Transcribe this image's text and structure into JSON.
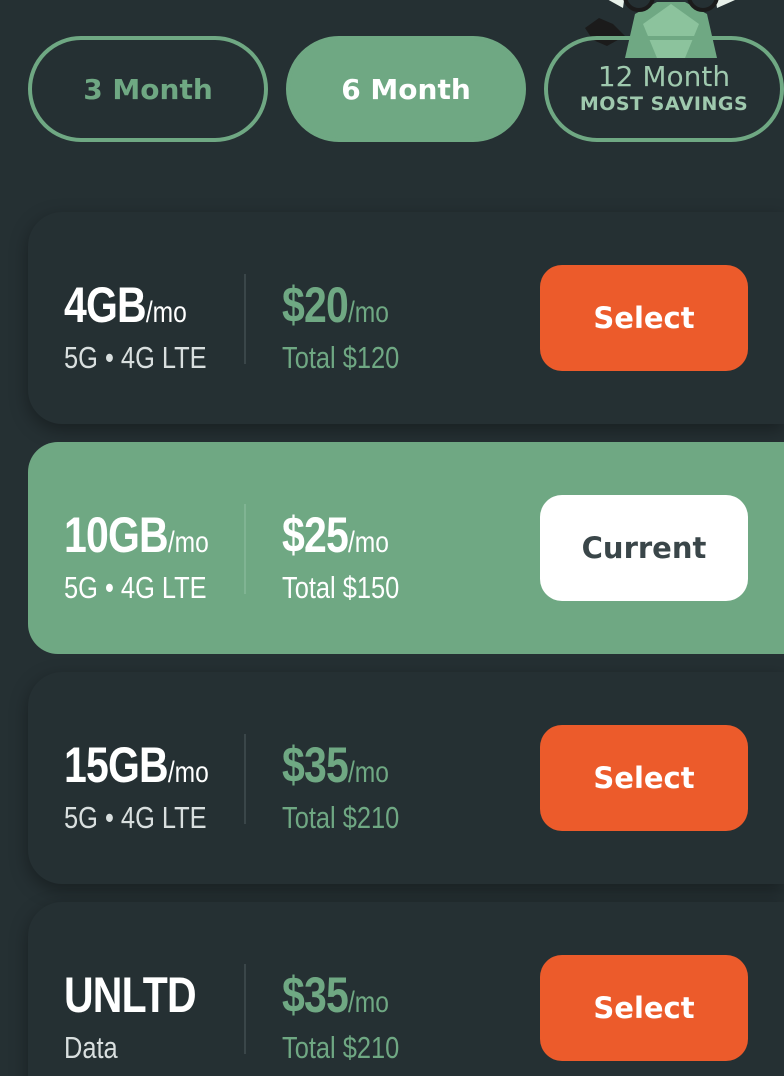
{
  "term_tabs": [
    {
      "label": "3 Month",
      "active": false
    },
    {
      "label": "6 Month",
      "active": true
    },
    {
      "label": "12 Month",
      "sublabel": "MOST SAVINGS",
      "active": false
    }
  ],
  "plans": [
    {
      "data": "4GB",
      "data_unit": "/mo",
      "network": "5G • 4G LTE",
      "price": "$20",
      "price_unit": "/mo",
      "total": "Total $120",
      "action": "Select",
      "current": false
    },
    {
      "data": "10GB",
      "data_unit": "/mo",
      "network": "5G • 4G LTE",
      "price": "$25",
      "price_unit": "/mo",
      "total": "Total $150",
      "action": "Current",
      "current": true
    },
    {
      "data": "15GB",
      "data_unit": "/mo",
      "network": "5G • 4G LTE",
      "price": "$35",
      "price_unit": "/mo",
      "total": "Total $210",
      "action": "Select",
      "current": false
    },
    {
      "data": "UNLTD",
      "data_unit": "",
      "network": "Data",
      "price": "$35",
      "price_unit": "/mo",
      "total": "Total $210",
      "action": "Select",
      "current": false
    }
  ],
  "colors": {
    "background": "#253033",
    "accent_green": "#6fa883",
    "select_orange": "#ec5b2b",
    "current_button": "#ffffff"
  },
  "icons": {
    "mascot": "mascot-character-icon"
  }
}
